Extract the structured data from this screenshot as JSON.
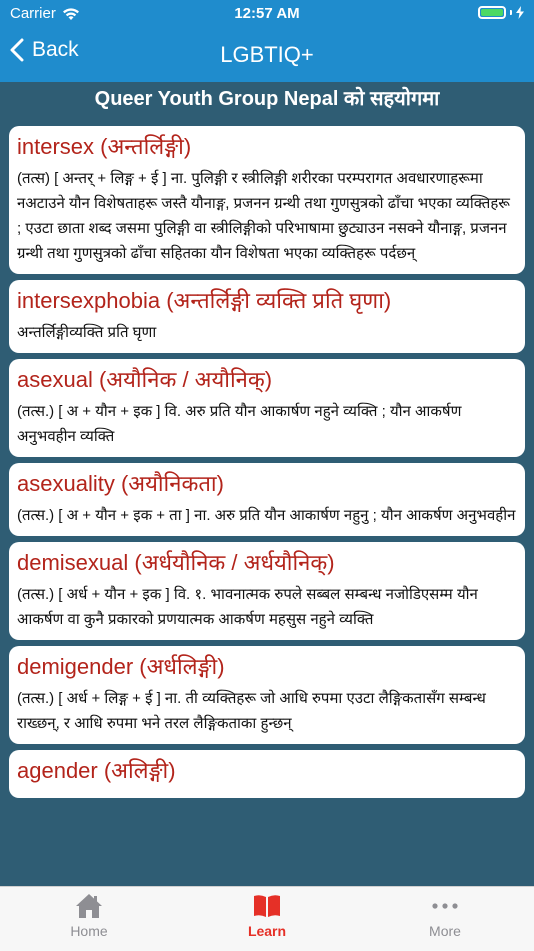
{
  "status": {
    "carrier": "Carrier",
    "time": "12:57 AM"
  },
  "nav": {
    "back_label": "Back",
    "title": "LGBTIQ+"
  },
  "subheader": "Queer Youth Group Nepal को सहयोगमा",
  "entries": [
    {
      "term": "intersex (अन्तर्लिङ्गी)",
      "definition": "(तत्स) [ अन्तर् + लिङ्ग + ई ] ना. पुलिङ्गी र स्त्रीलिङ्गी शरीरका परम्परागत अवधारणाहरूमा नअटाउने यौन विशेषताहरू जस्तै यौनाङ्ग, प्रजनन ग्रन्थी तथा गुणसुत्रको ढाँचा भएका व्यक्तिहरू ; एउटा छाता शब्द जसमा पुलिङ्गी वा स्त्रीलिङ्गीको परिभाषामा छुट्याउन नसक्ने यौनाङ्ग, प्रजनन ग्रन्थी तथा गुणसुत्रको ढाँचा सहितका यौन विशेषता भएका व्यक्तिहरू पर्दछन्"
    },
    {
      "term": "intersexphobia (अन्तर्लिङ्गी व्यक्ति प्रति घृणा)",
      "definition": "अन्तर्लिङ्गीव्यक्ति प्रति घृणा"
    },
    {
      "term": "asexual (अयौनिक / अयौनिक्)",
      "definition": "(तत्स.) [ अ + यौन + इक ] वि. अरु प्रति यौन आकार्षण नहुने व्यक्ति ; यौन आकर्षण अनुभवहीन व्यक्ति"
    },
    {
      "term": "asexuality (अयौनिकता)",
      "definition": "(तत्स.) [ अ + यौन + इक + ता ] ना. अरु प्रति यौन आकार्षण नहुनु ; यौन आकर्षण अनुभवहीन"
    },
    {
      "term": "demisexual (अर्धयौनिक / अर्धयौनिक्)",
      "definition": "(तत्स.) [ अर्ध + यौन + इक ] वि. १. भावनात्मक रुपले सब्बल सम्बन्ध नजोडिएसम्म यौन आकर्षण वा कुनै प्रकारको प्रणयात्मक आकर्षण महसुस नहुने व्यक्ति"
    },
    {
      "term": "demigender (अर्धलिङ्गी)",
      "definition": "(तत्स.) [ अर्ध + लिङ्ग + ई ] ना. ती व्यक्तिहरू जो आधि रुपमा एउटा लैङ्गिकतासँग सम्बन्ध राख्छन्, र आधि रुपमा भने तरल लैङ्गिकताका हुन्छन्"
    },
    {
      "term": "agender (अलिङ्गी)",
      "definition": ""
    }
  ],
  "tabs": [
    {
      "label": "Home",
      "icon": "house-icon"
    },
    {
      "label": "Learn",
      "icon": "book-icon"
    },
    {
      "label": "More",
      "icon": "more-dots-icon"
    }
  ],
  "colors": {
    "bar": "#1f8ccd",
    "background": "#2f5d74",
    "term": "#b3241b",
    "active_tab": "#e53027",
    "inactive_tab": "#8e8e93"
  }
}
